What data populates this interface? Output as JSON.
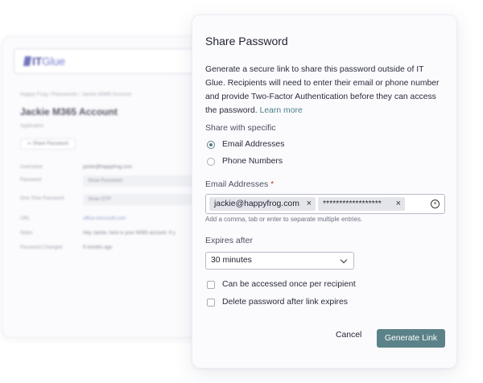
{
  "background_app": {
    "logo_it": "IT",
    "logo_glue": "Glue",
    "breadcrumb": "Happy Frog  /  Passwords  /  Jackie M365 Account",
    "title": "Jackie M365 Account",
    "subtitle": "Application",
    "chip": "⇐  Share Password",
    "rows": [
      {
        "label": "Username",
        "value": "jackie@happyfrog.com",
        "kind": "text"
      },
      {
        "label": "Password",
        "value": "Show Password",
        "kind": "box"
      },
      {
        "label": "One-Time Password",
        "value": "Show OTP",
        "kind": "box"
      },
      {
        "label": "URL",
        "value": "office.microsoft.com",
        "kind": "link"
      },
      {
        "label": "Notes",
        "value": "Hey Jackie, here is your M365 account. If y",
        "kind": "text"
      },
      {
        "label": "Password Changed",
        "value": "9 months ago",
        "kind": "text"
      }
    ]
  },
  "dialog": {
    "title": "Share Password",
    "description": "Generate a secure link to share this password outside of IT Glue. Recipients will need to enter their email or phone number and provide Two-Factor Authentication before they can access the password.",
    "learn_more": "Learn more",
    "share_with_label": "Share with specific",
    "share_options": [
      {
        "label": "Email Addresses",
        "selected": true
      },
      {
        "label": "Phone Numbers",
        "selected": false
      }
    ],
    "email_label": "Email Addresses",
    "required_marker": "*",
    "tags": [
      {
        "text": "jackie@happyfrog.com"
      },
      {
        "text": "******************"
      }
    ],
    "tag_remove": "×",
    "clear_symbol": "×",
    "hint": "Add a comma, tab or enter to separate multiple entries.",
    "expires_label": "Expires after",
    "expires_value": "30 minutes",
    "checkboxes": [
      {
        "label": "Can be accessed once per recipient",
        "checked": false
      },
      {
        "label": "Delete password after link expires",
        "checked": false
      }
    ],
    "cancel_label": "Cancel",
    "generate_label": "Generate Link"
  },
  "colors": {
    "accent": "#5b8288",
    "link": "#4a7e87",
    "required": "#c0392b",
    "logo": "#5b5fb5"
  },
  "icons": [
    "close-icon",
    "clear-circle-icon",
    "chevron-down-icon"
  ]
}
